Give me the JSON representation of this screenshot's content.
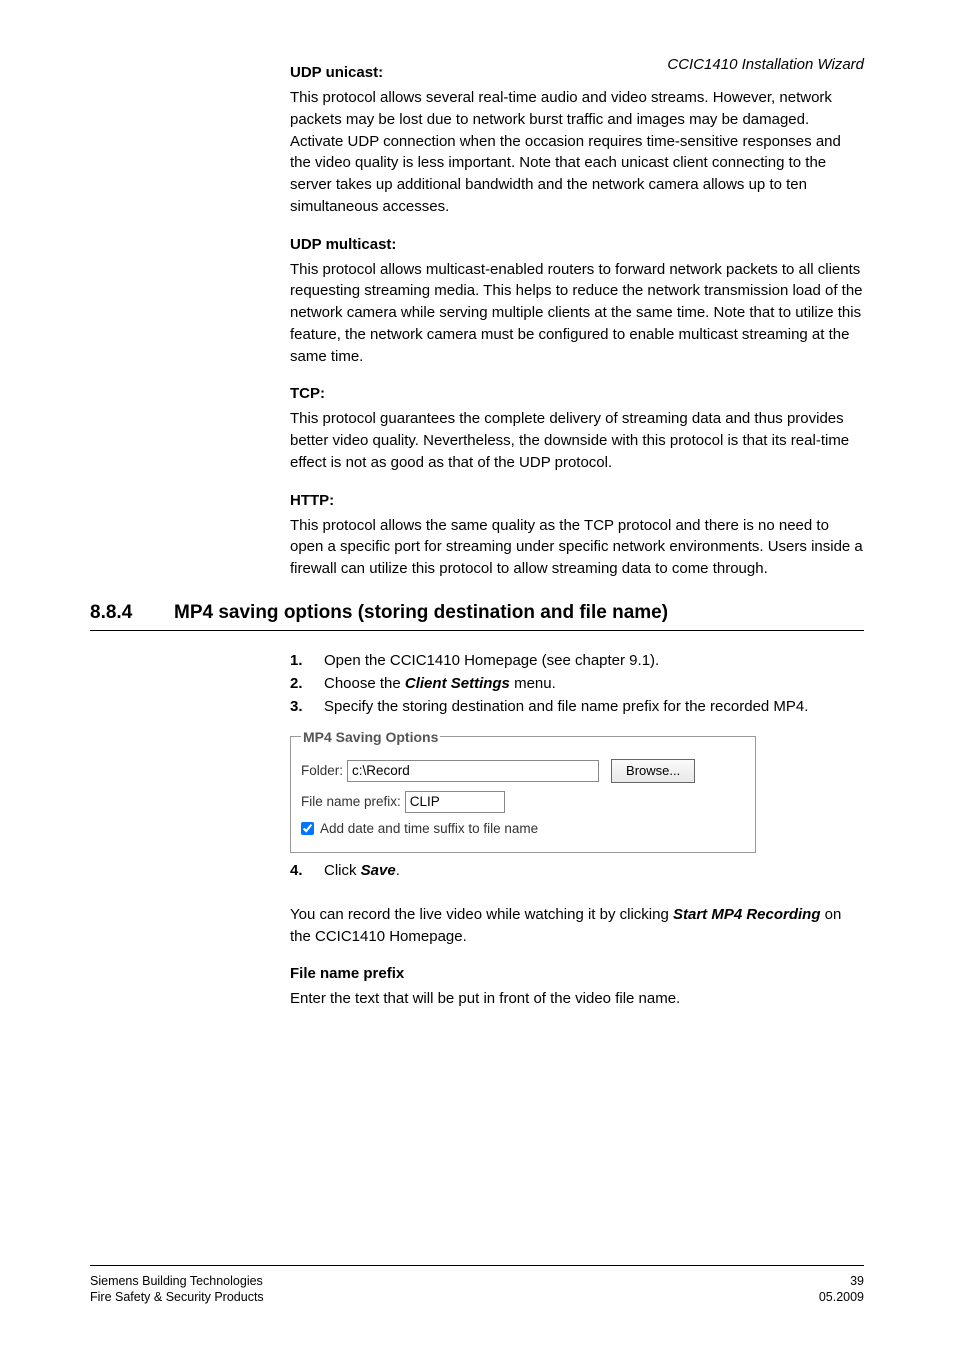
{
  "header": {
    "doc_title": "CCIC1410 Installation Wizard"
  },
  "udp_unicast": {
    "title": "UDP unicast:",
    "body": "This protocol allows several real-time audio and video streams. However, network packets may be lost due to network burst traffic and images may be damaged. Activate UDP connection when the occasion requires time-sensitive responses and the video quality is less important. Note that each unicast client connecting to the server takes up additional bandwidth and the network camera allows up to ten simultaneous accesses."
  },
  "udp_multicast": {
    "title": "UDP multicast:",
    "body": "This protocol allows multicast-enabled routers to forward network packets to all clients requesting streaming media. This helps to reduce the network transmission load of the network camera while serving multiple clients at the same time. Note that to utilize this feature, the network camera must be configured to enable multicast streaming at the same time."
  },
  "tcp": {
    "title": "TCP:",
    "body": "This protocol guarantees the complete delivery of streaming data and thus provides better video quality. Nevertheless, the downside with this protocol is that its real-time effect is not as good as that of the UDP protocol."
  },
  "http": {
    "title": "HTTP:",
    "body": "This protocol allows the same quality as the TCP protocol and there is no need to open a specific port for streaming under specific network environments. Users inside a firewall can utilize this protocol to allow streaming data to come through."
  },
  "section": {
    "num": "8.8.4",
    "title": "MP4 saving options (storing destination and file name)"
  },
  "steps": {
    "s1": {
      "n": "1.",
      "pre": "Open the CCIC1410 Homepage (see chapter 9.1)."
    },
    "s2": {
      "n": "2.",
      "pre": "Choose the ",
      "bold": "Client Settings",
      "post": " menu."
    },
    "s3": {
      "n": "3.",
      "pre": "Specify the storing destination and file name prefix for the recorded MP4."
    },
    "s4": {
      "n": "4.",
      "pre": "Click ",
      "bold": "Save",
      "post": "."
    }
  },
  "figure": {
    "legend": "MP4 Saving Options",
    "folder_label": "Folder:",
    "folder_value": "c:\\Record",
    "browse_label": "Browse...",
    "prefix_label": "File name prefix:",
    "prefix_value": "CLIP",
    "chk_label": "Add date and time suffix to file name",
    "chk_checked": true
  },
  "after_steps": {
    "pre": "You can record the live video while watching it by clicking ",
    "bold": "Start MP4 Recording",
    "post": " on the CCIC1410 Homepage."
  },
  "file_prefix": {
    "title": "File name prefix",
    "body": "Enter the text that will be put in front of the video file name."
  },
  "footer": {
    "page": "39",
    "company": "Siemens Building Technologies",
    "line2": "Fire Safety & Security Products",
    "date": "05.2009"
  }
}
